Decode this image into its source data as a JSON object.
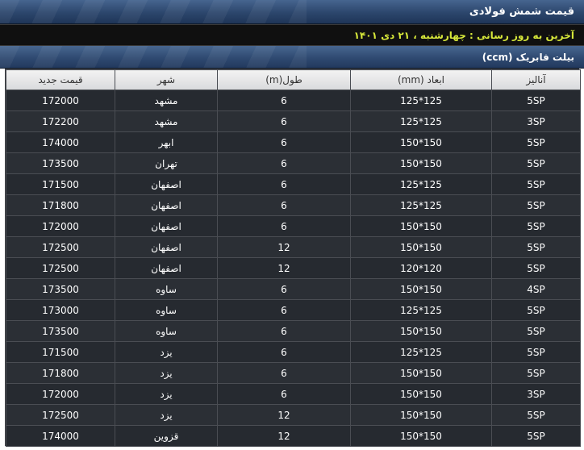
{
  "header": {
    "title": "قیمت شمش فولادی",
    "last_update": "آخرین به روز رسانی : چهارشنبه ، ۲۱ دی ۱۴۰۱"
  },
  "section": {
    "title": "بیلت فابریک (ccm)"
  },
  "table": {
    "columns": [
      "آنالیز",
      "ابعاد (mm)",
      "طول(m)",
      "شهر",
      "قیمت جدید"
    ],
    "rows": [
      {
        "analysis": "5SP",
        "dimensions": "125*125",
        "length": "6",
        "city": "مشهد",
        "price": "172000"
      },
      {
        "analysis": "3SP",
        "dimensions": "125*125",
        "length": "6",
        "city": "مشهد",
        "price": "172200"
      },
      {
        "analysis": "5SP",
        "dimensions": "150*150",
        "length": "6",
        "city": "ابهر",
        "price": "174000"
      },
      {
        "analysis": "5SP",
        "dimensions": "150*150",
        "length": "6",
        "city": "تهران",
        "price": "173500"
      },
      {
        "analysis": "5SP",
        "dimensions": "125*125",
        "length": "6",
        "city": "اصفهان",
        "price": "171500"
      },
      {
        "analysis": "5SP",
        "dimensions": "125*125",
        "length": "6",
        "city": "اصفهان",
        "price": "171800"
      },
      {
        "analysis": "5SP",
        "dimensions": "150*150",
        "length": "6",
        "city": "اصفهان",
        "price": "172000"
      },
      {
        "analysis": "5SP",
        "dimensions": "150*150",
        "length": "12",
        "city": "اصفهان",
        "price": "172500"
      },
      {
        "analysis": "5SP",
        "dimensions": "120*120",
        "length": "12",
        "city": "اصفهان",
        "price": "172500"
      },
      {
        "analysis": "4SP",
        "dimensions": "150*150",
        "length": "6",
        "city": "ساوه",
        "price": "173500"
      },
      {
        "analysis": "5SP",
        "dimensions": "125*125",
        "length": "6",
        "city": "ساوه",
        "price": "173000"
      },
      {
        "analysis": "5SP",
        "dimensions": "150*150",
        "length": "6",
        "city": "ساوه",
        "price": "173500"
      },
      {
        "analysis": "5SP",
        "dimensions": "125*125",
        "length": "6",
        "city": "یزد",
        "price": "171500"
      },
      {
        "analysis": "5SP",
        "dimensions": "150*150",
        "length": "6",
        "city": "یزد",
        "price": "171800"
      },
      {
        "analysis": "3SP",
        "dimensions": "150*150",
        "length": "6",
        "city": "یزد",
        "price": "172000"
      },
      {
        "analysis": "5SP",
        "dimensions": "150*150",
        "length": "12",
        "city": "یزد",
        "price": "172500"
      },
      {
        "analysis": "5SP",
        "dimensions": "150*150",
        "length": "12",
        "city": "قزوین",
        "price": "174000"
      }
    ]
  },
  "colors": {
    "header_blue": "#2c466c",
    "update_text": "#d7e83a",
    "table_bg": "#262a30",
    "table_header_bg": "#e6e6e6"
  }
}
